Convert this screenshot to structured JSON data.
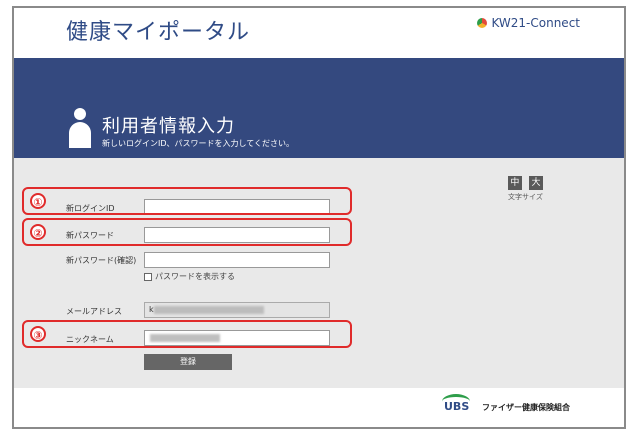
{
  "header": {
    "app_title": "健康マイポータル",
    "brand": "KW21-Connect"
  },
  "banner": {
    "title": "利用者情報入力",
    "subtitle": "新しいログインID、パスワードを入力してください。"
  },
  "font_size": {
    "medium": "中",
    "large": "大",
    "label": "文字サイズ"
  },
  "form": {
    "new_login_id_label": "新ログインID",
    "new_login_id_value": "",
    "new_password_label": "新パスワード",
    "new_password_value": "",
    "confirm_password_label": "新パスワード(確認)",
    "confirm_password_value": "",
    "show_password_label": "パスワードを表示する",
    "email_label": "メールアドレス",
    "email_value": "k",
    "nickname_label": "ニックネーム",
    "nickname_value": "",
    "submit_label": "登録"
  },
  "markers": [
    "①",
    "②",
    "③"
  ],
  "footer": {
    "logo": "UBS",
    "org_name": "ファイザー健康保険組合"
  },
  "colors": {
    "accent": "#34497f",
    "marker": "#e02b2b"
  }
}
